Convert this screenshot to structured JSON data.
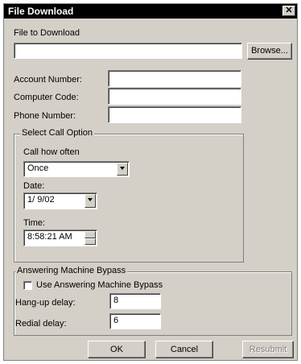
{
  "window": {
    "title": "File Download",
    "close_glyph": "✕"
  },
  "file": {
    "label": "File to Download",
    "value": "",
    "browse_label": "Browse..."
  },
  "account": {
    "label": "Account Number:",
    "value": ""
  },
  "computer": {
    "label": "Computer Code:",
    "value": ""
  },
  "phone": {
    "label": "Phone Number:",
    "value": ""
  },
  "call_option": {
    "legend": "Select Call Option",
    "how_often_label": "Call how often",
    "how_often_value": "Once",
    "date_label": "Date:",
    "date_value": "1/ 9/02",
    "time_label": "Time:",
    "time_value": "8:58:21 AM"
  },
  "bypass": {
    "legend": "Answering Machine Bypass",
    "use_label": "Use Answering Machine Bypass",
    "use_checked": false,
    "hangup_label": "Hang-up delay:",
    "hangup_value": "8",
    "redial_label": "Redial delay:",
    "redial_value": "6"
  },
  "buttons": {
    "ok": "OK",
    "cancel": "Cancel",
    "resubmit": "Resubmit"
  }
}
